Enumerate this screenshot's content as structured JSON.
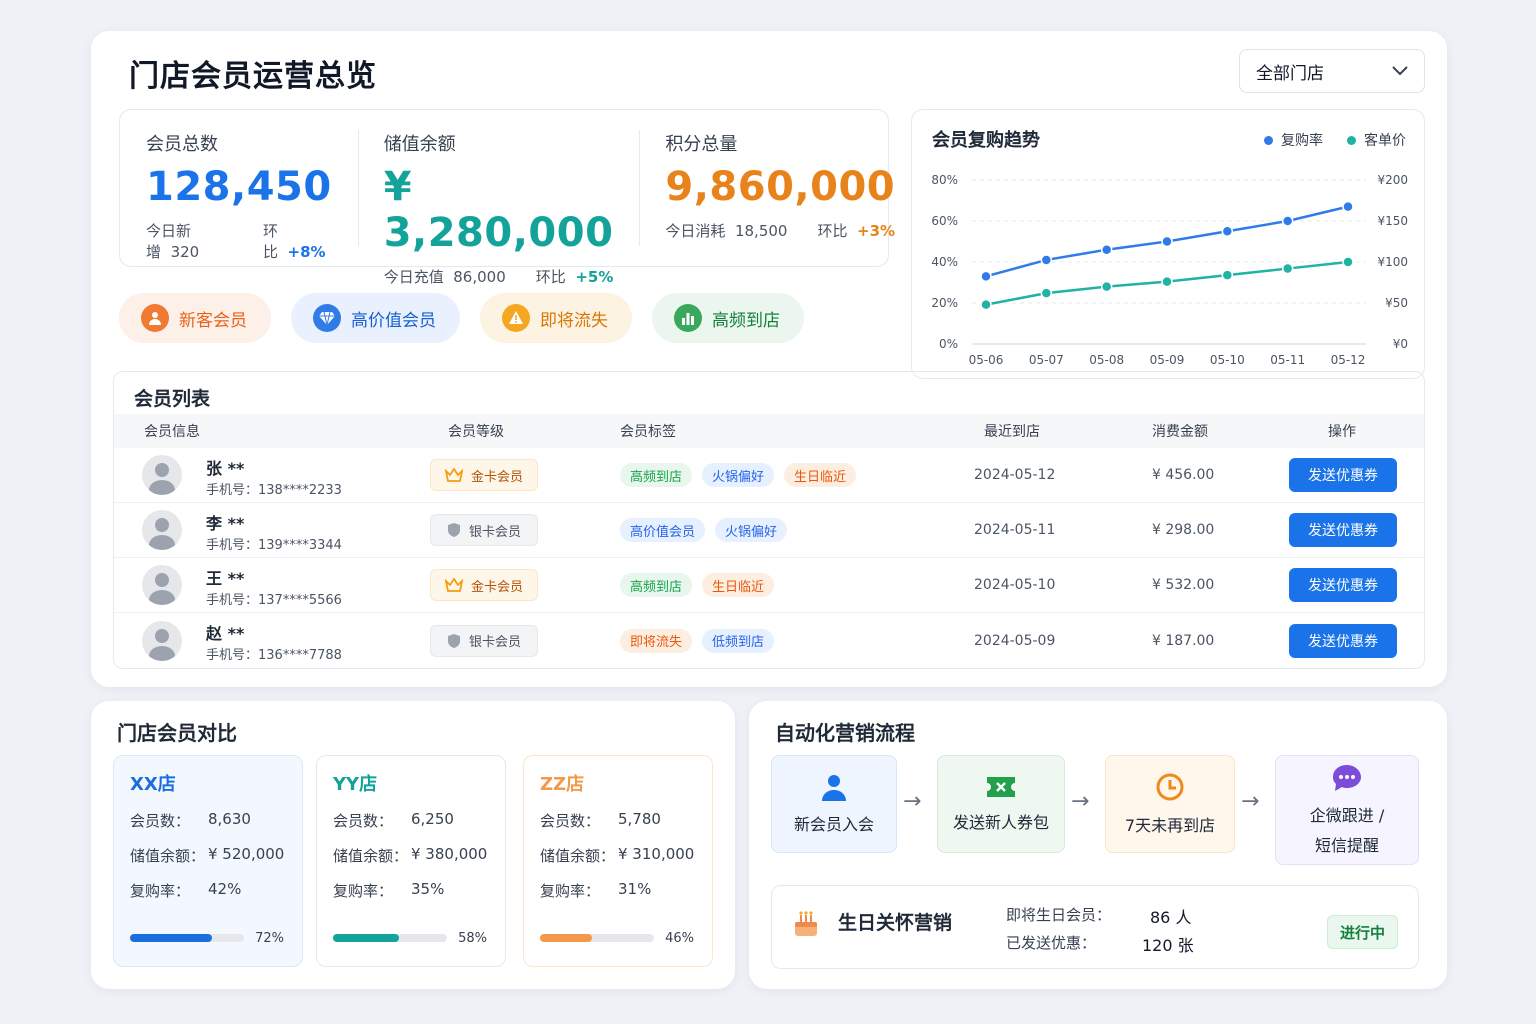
{
  "header": {
    "title": "门店会员运营总览",
    "store_select": "全部门店"
  },
  "stats": [
    {
      "label": "会员总数",
      "value": "128,450",
      "sub1_label": "今日新增",
      "sub1_value": "320",
      "cmp_label": "环比",
      "cmp_value": "+8%",
      "color": "#1a73e8"
    },
    {
      "label": "储值余额",
      "value": "¥ 3,280,000",
      "sub1_label": "今日充值",
      "sub1_value": "86,000",
      "cmp_label": "环比",
      "cmp_value": "+5%",
      "color": "#14a39a"
    },
    {
      "label": "积分总量",
      "value": "9,860,000",
      "sub1_label": "今日消耗",
      "sub1_value": "18,500",
      "cmp_label": "环比",
      "cmp_value": "+3%",
      "color": "#e8821a"
    }
  ],
  "segments": [
    {
      "label": "新客会员",
      "icon": "person-icon"
    },
    {
      "label": "高价值会员",
      "icon": "diamond-icon"
    },
    {
      "label": "即将流失",
      "icon": "warning-icon"
    },
    {
      "label": "高频到店",
      "icon": "bar-chart-icon"
    }
  ],
  "chart_data": {
    "type": "line",
    "title": "会员复购趋势",
    "categories": [
      "05-06",
      "05-07",
      "05-08",
      "05-09",
      "05-10",
      "05-11",
      "05-12"
    ],
    "series": [
      {
        "name": "复购率",
        "axis": "left",
        "color": "#2f7be8",
        "values": [
          33,
          41,
          46,
          50,
          55,
          60,
          67
        ]
      },
      {
        "name": "客单价",
        "axis": "right",
        "color": "#1fb3a3",
        "values": [
          48,
          62,
          70,
          76,
          84,
          92,
          100
        ]
      }
    ],
    "y_left": {
      "min": 0,
      "max": 80,
      "ticks": [
        "0%",
        "20%",
        "40%",
        "60%",
        "80%"
      ]
    },
    "y_right": {
      "min": 0,
      "max": 200,
      "ticks": [
        "¥0",
        "¥50",
        "¥100",
        "¥150",
        "¥200"
      ]
    },
    "grid": true,
    "legend": "top-right"
  },
  "member_list": {
    "title": "会员列表",
    "headers": [
      "会员信息",
      "会员等级",
      "会员标签",
      "最近到店",
      "消费金额",
      "操作"
    ],
    "phone_label": "手机号：",
    "rows": [
      {
        "name": "张 **",
        "phone": "138****2233",
        "level": "金卡会员",
        "level_type": "gold",
        "tags": [
          {
            "t": "高频到店",
            "c": "green"
          },
          {
            "t": "火锅偏好",
            "c": "blue"
          },
          {
            "t": "生日临近",
            "c": "orange"
          }
        ],
        "date": "2024-05-12",
        "amount": "¥ 456.00",
        "action": "发送优惠券"
      },
      {
        "name": "李 **",
        "phone": "139****3344",
        "level": "银卡会员",
        "level_type": "silver",
        "tags": [
          {
            "t": "高价值会员",
            "c": "blue"
          },
          {
            "t": "火锅偏好",
            "c": "blue"
          }
        ],
        "date": "2024-05-11",
        "amount": "¥ 298.00",
        "action": "发送优惠券"
      },
      {
        "name": "王 **",
        "phone": "137****5566",
        "level": "金卡会员",
        "level_type": "gold",
        "tags": [
          {
            "t": "高频到店",
            "c": "green"
          },
          {
            "t": "生日临近",
            "c": "orange"
          }
        ],
        "date": "2024-05-10",
        "amount": "¥ 532.00",
        "action": "发送优惠券"
      },
      {
        "name": "赵 **",
        "phone": "136****7788",
        "level": "银卡会员",
        "level_type": "silver",
        "tags": [
          {
            "t": "即将流失",
            "c": "orange"
          },
          {
            "t": "低频到店",
            "c": "blue"
          }
        ],
        "date": "2024-05-09",
        "amount": "¥ 187.00",
        "action": "发送优惠券"
      }
    ]
  },
  "store_compare": {
    "title": "门店会员对比",
    "labels": {
      "members": "会员数：",
      "balance": "储值余额：",
      "repurchase": "复购率："
    },
    "stores": [
      {
        "name": "XX店",
        "members": "8,630",
        "balance": "¥ 520,000",
        "repurchase": "42%",
        "progress": 72,
        "progress_label": "72%",
        "color": "#1a6fe0",
        "bg": "#f3f8ff",
        "border": "#dbe8fb"
      },
      {
        "name": "YY店",
        "members": "6,250",
        "balance": "¥ 380,000",
        "repurchase": "35%",
        "progress": 58,
        "progress_label": "58%",
        "color": "#14a39a",
        "bg": "#ffffff",
        "border": "#e5e8ee"
      },
      {
        "name": "ZZ店",
        "members": "5,780",
        "balance": "¥ 310,000",
        "repurchase": "31%",
        "progress": 46,
        "progress_label": "46%",
        "color": "#f39a4a",
        "bg": "#ffffff",
        "border": "#fde6cf"
      }
    ]
  },
  "automation": {
    "title": "自动化营销流程",
    "steps": [
      {
        "label": "新会员入会",
        "icon": "user-icon"
      },
      {
        "label": "发送新人券包",
        "icon": "ticket-icon"
      },
      {
        "label": "7天未再到店",
        "icon": "clock-icon"
      },
      {
        "label": "企微跟进 /",
        "label2": "短信提醒",
        "icon": "chat-icon"
      }
    ],
    "birthday": {
      "title": "生日关怀营销",
      "upcoming_label": "即将生日会员：",
      "upcoming_value": "86 人",
      "sent_label": "已发送优惠：",
      "sent_value": "120 张",
      "status": "进行中"
    }
  }
}
